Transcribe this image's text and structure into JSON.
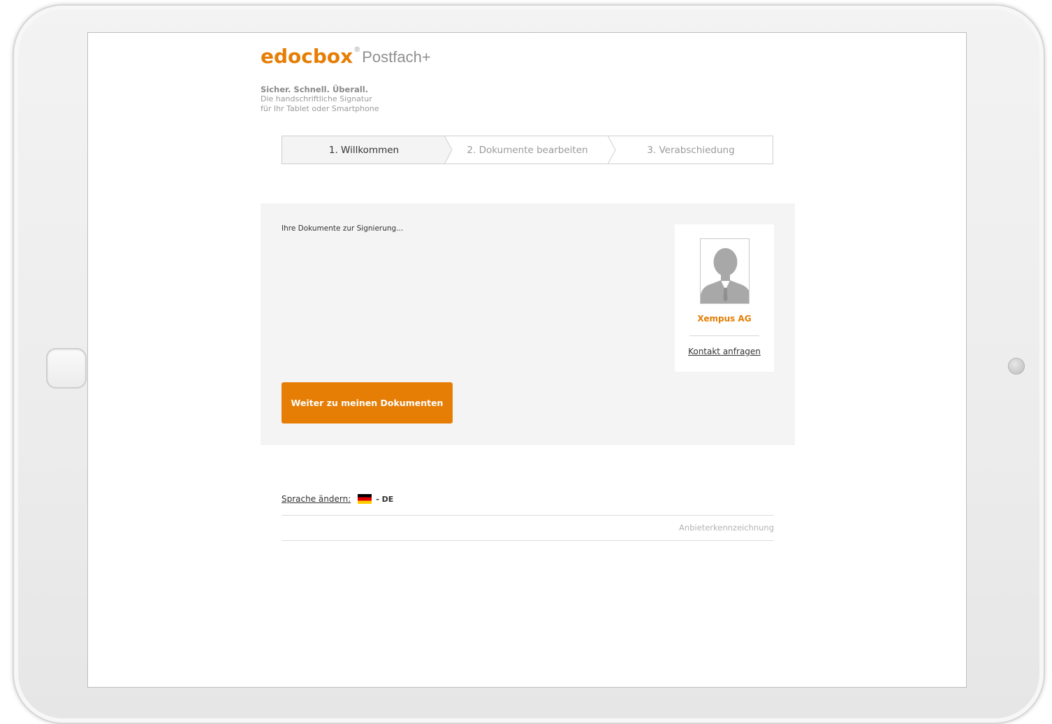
{
  "brand": {
    "logo_mark": "edocbox",
    "registered": "®",
    "product": "Postfach+",
    "accent_color": "#e67e05"
  },
  "tagline": {
    "headline": "Sicher. Schnell. Überall.",
    "line1": "Die handschriftliche Signatur",
    "line2": "für Ihr Tablet oder Smartphone"
  },
  "stepper": {
    "steps": [
      {
        "label": "1. Willkommen",
        "active": true
      },
      {
        "label": "2. Dokumente bearbeiten",
        "active": false
      },
      {
        "label": "3. Verabschiedung",
        "active": false
      }
    ]
  },
  "panel": {
    "title": "Ihre Dokumente zur Signierung...",
    "card": {
      "avatar_icon": "person-silhouette-icon",
      "company": "Xempus AG",
      "contact_label": "Kontakt anfragen"
    },
    "primary_button": "Weiter zu meinen Dokumenten"
  },
  "footer": {
    "language_label": "Sprache ändern:",
    "flag_icon": "flag-de-icon",
    "language_code": "- DE",
    "imprint": "Anbieterkennzeichnung"
  }
}
